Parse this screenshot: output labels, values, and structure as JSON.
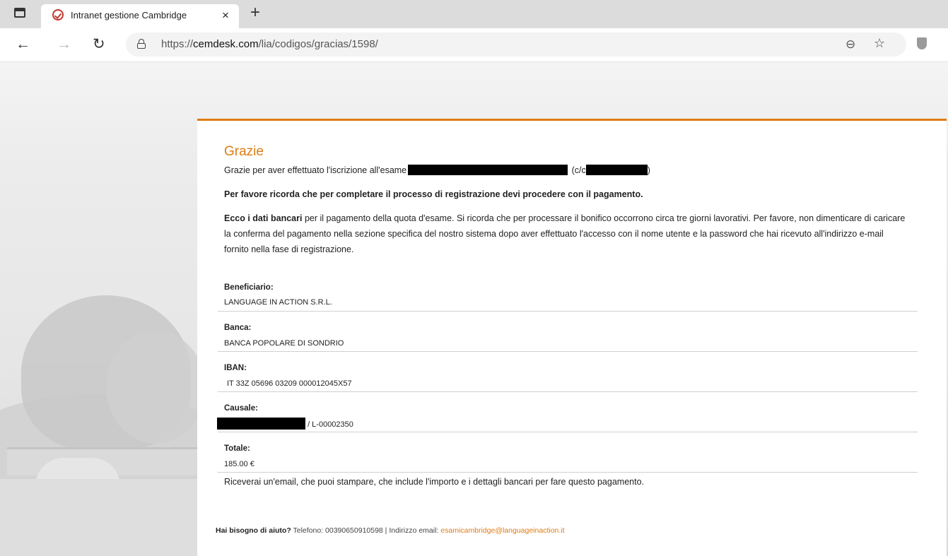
{
  "browser": {
    "tab_title": "Intranet gestione Cambridge",
    "tab_close": "×",
    "new_tab": "+",
    "url_prefix": "https://",
    "url_host": "cemdesk.com",
    "url_path": "/lia/codigos/gracias/1598/"
  },
  "page": {
    "title": "Grazie",
    "intro_prefix": "Grazie per aver effettuato l'iscrizione all'esame",
    "intro_mid": "(c/c",
    "intro_suffix": ")",
    "reminder": "Per favore ricorda che per completare il processo di registrazione devi procedere con il pagamento.",
    "bank_intro_bold": "Ecco i dati bancari",
    "bank_intro_text": " per il pagamento della quota d'esame. Si ricorda che per processare il bonifico occorrono circa tre giorni lavorativi. Per favore, non dimenticare di caricare la conferma del pagamento nella sezione specifica del nostro sistema dopo aver effettuato l'accesso con il nome utente e la password che hai ricevuto all'indirizzo e-mail fornito nella fase di registrazione.",
    "fields": {
      "beneficiario_label": "Beneficiario:",
      "beneficiario_value": "LANGUAGE IN ACTION S.R.L.",
      "banca_label": "Banca:",
      "banca_value": "BANCA POPOLARE DI SONDRIO",
      "iban_label": "IBAN:",
      "iban_value": "IT 33Z 05696 03209 000012045X57",
      "causale_label": "Causale:",
      "causale_value": "/ L-00002350",
      "totale_label": "Totale:",
      "totale_value": "185.00 €"
    },
    "email_note": "Riceverai un'email, che puoi stampare, che include l'importo e i dettagli bancari per fare questo pagamento.",
    "footer": {
      "help_label": "Hai bisogno di aiuto?",
      "phone_text": " Telefono: 00390650910598 | Indirizzo email: ",
      "email": "esamicambridge@languageinaction.it"
    }
  },
  "colors": {
    "accent": "#e07b12"
  }
}
